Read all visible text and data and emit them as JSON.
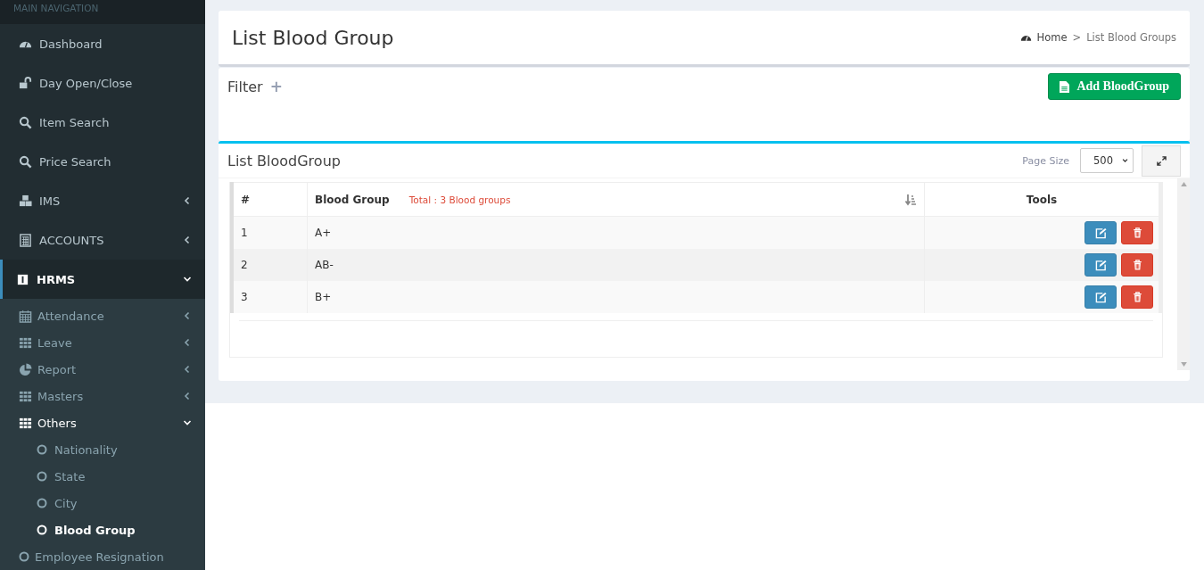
{
  "sidebar": {
    "header": "MAIN NAVIGATION",
    "items": [
      {
        "label": "Dashboard"
      },
      {
        "label": "Day Open/Close"
      },
      {
        "label": "Item Search"
      },
      {
        "label": "Price Search"
      },
      {
        "label": "IMS",
        "expanded": false
      },
      {
        "label": "ACCOUNTS",
        "expanded": false
      },
      {
        "label": "HRMS",
        "expanded": true,
        "selected": true,
        "children": [
          {
            "label": "Attendance",
            "expanded": false
          },
          {
            "label": "Leave",
            "expanded": false
          },
          {
            "label": "Report",
            "expanded": false
          },
          {
            "label": "Masters",
            "expanded": false
          },
          {
            "label": "Others",
            "expanded": true,
            "children": [
              {
                "label": "Nationality",
                "selected": false
              },
              {
                "label": "State",
                "selected": false
              },
              {
                "label": "City",
                "selected": false
              },
              {
                "label": "Blood Group",
                "selected": true
              }
            ]
          },
          {
            "label": "Employee Resignation"
          }
        ]
      }
    ]
  },
  "page": {
    "title": "List Blood Group",
    "breadcrumb": [
      "Home",
      ">",
      "List Blood Groups"
    ]
  },
  "filter": {
    "title": "Filter",
    "toggle": "+",
    "add_button": "Add BloodGroup"
  },
  "list": {
    "title": "List BloodGroup",
    "page_size_label": "Page Size",
    "page_size": "500",
    "table": {
      "columns": [
        "#",
        "Blood Group",
        "Tools"
      ],
      "total": "Total : 3 Blood groups",
      "rows": [
        {
          "index": "1",
          "name": "A+"
        },
        {
          "index": "2",
          "name": "AB-"
        },
        {
          "index": "3",
          "name": "B+"
        }
      ]
    }
  }
}
